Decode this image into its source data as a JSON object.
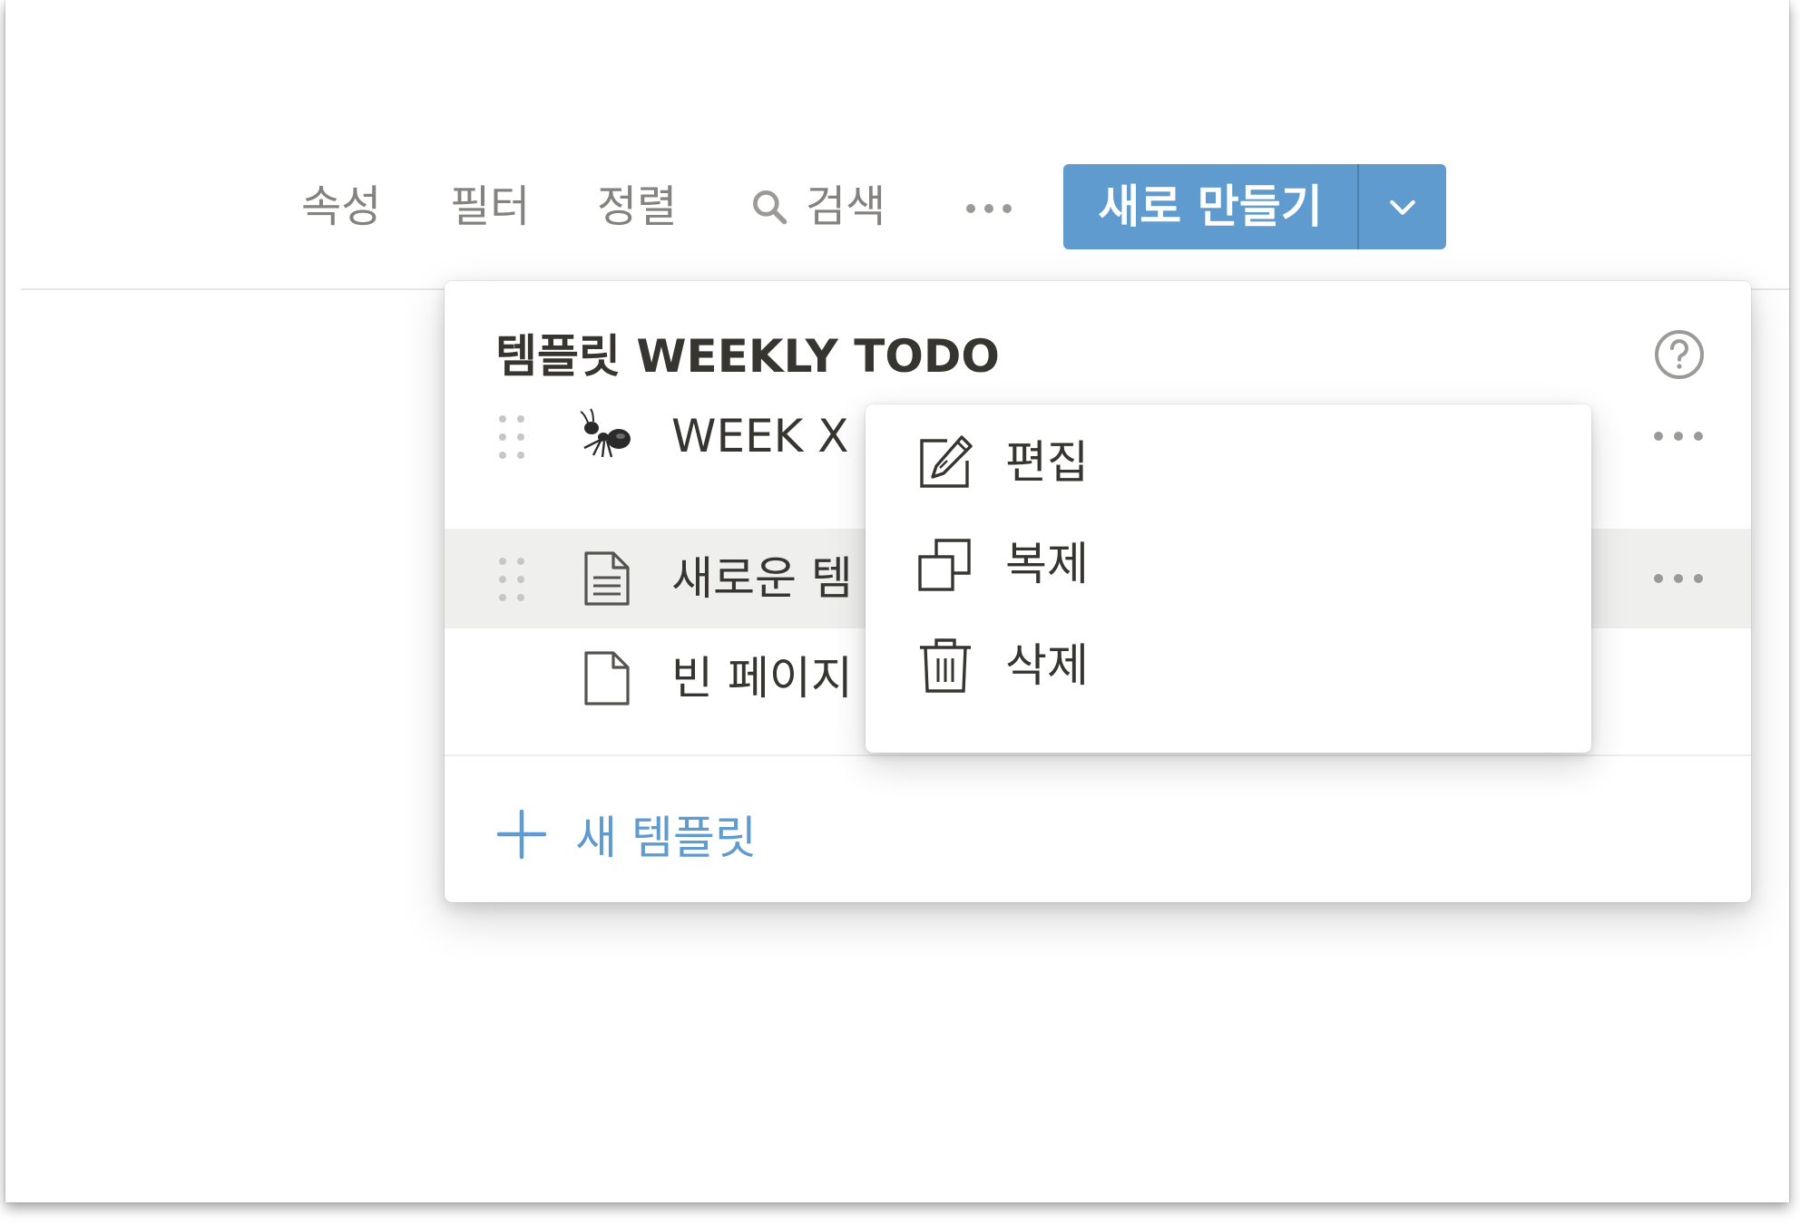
{
  "toolbar": {
    "properties": "속성",
    "filter": "필터",
    "sort": "정렬",
    "search": "검색",
    "more_icon": "more-horizontal-icon",
    "new_button": "새로 만들기",
    "new_caret_icon": "chevron-down-icon"
  },
  "colors": {
    "accent": "#5f9bcf",
    "text": "#37352f",
    "muted": "#9b9a97",
    "hover_row": "#efefee"
  },
  "template_popup": {
    "title": "템플릿 WEEKLY TODO",
    "help_icon": "help-circle-icon",
    "items": [
      {
        "icon": "ant-emoji-icon",
        "label": "WEEK X"
      },
      {
        "icon": "document-lines-icon",
        "label": "새로운 템"
      },
      {
        "icon": "blank-page-icon",
        "label": "빈 페이지"
      }
    ],
    "new_template": "새 템플릿"
  },
  "context_menu": {
    "items": [
      {
        "icon": "pencil-edit-icon",
        "label": "편집"
      },
      {
        "icon": "duplicate-icon",
        "label": "복제"
      },
      {
        "icon": "trash-icon",
        "label": "삭제"
      }
    ]
  }
}
